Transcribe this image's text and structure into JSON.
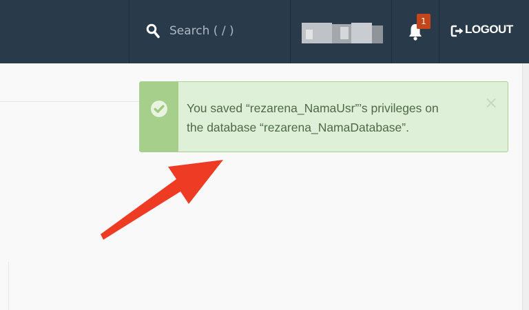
{
  "header": {
    "search": {
      "placeholder": "Search ( / )",
      "icon": "search-icon"
    },
    "notifications": {
      "icon": "bell-icon",
      "badge_count": "1"
    },
    "logout": {
      "icon": "logout-icon",
      "label": "LOGOUT"
    }
  },
  "alert": {
    "icon": "check-circle-icon",
    "line1": "You saved “rezarena_NamaUsr”’s privileges on",
    "line2": "the database “rezarena_NamaDatabase”.",
    "close_label": "×"
  },
  "colors": {
    "header_bg": "#293a4a",
    "alert_bg": "#dff0d8",
    "alert_icon_bg": "#a5cf8a",
    "badge_bg": "#c2461a",
    "arrow": "#ee3b24"
  }
}
